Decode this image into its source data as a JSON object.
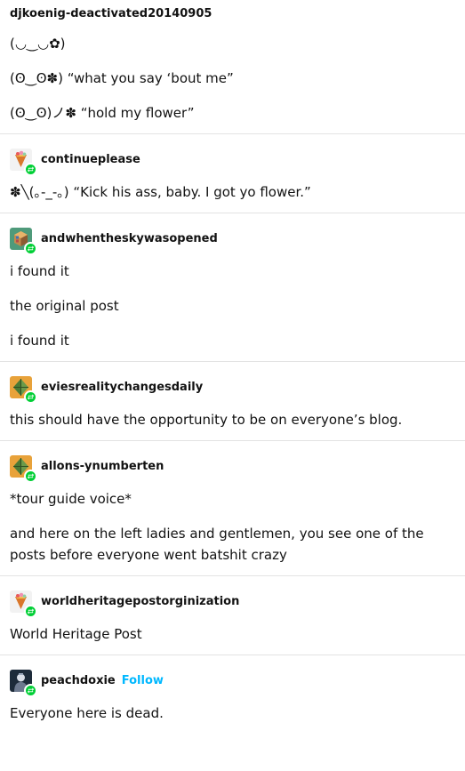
{
  "original": {
    "blog": "djkoenig-deactivated20140905",
    "paragraphs": [
      "(◡‿◡✿)",
      "(ʘ‿ʘ✽) “what you say ‘bout me”",
      "(ʘ‿ʘ)ノ✽ “hold my flower”"
    ]
  },
  "reblogs": [
    {
      "blog": "continueplease",
      "avatar": "ice-cream-cone-avatar",
      "paragraphs": [
        "✽╲(｡-_-｡) “Kick his ass, baby.  I got yo flower.”"
      ]
    },
    {
      "blog": "andwhentheskywasopened",
      "avatar": "cube-avatar",
      "paragraphs": [
        "i found it",
        "the original post",
        "i found it"
      ]
    },
    {
      "blog": "eviesrealitychangesdaily",
      "avatar": "polyhedron-avatar",
      "paragraphs": [
        "this should have the opportunity to be on everyone’s blog."
      ]
    },
    {
      "blog": "allons-ynumberten",
      "avatar": "polyhedron-avatar",
      "paragraphs": [
        "*tour guide voice*",
        "and here on the left ladies and gentlemen, you see one of the posts before everyone went batshit crazy"
      ]
    },
    {
      "blog": "worldheritagepostorginization",
      "avatar": "ice-cream-cone-avatar",
      "paragraphs": [
        "World Heritage Post"
      ]
    },
    {
      "blog": "peachdoxie",
      "avatar": "portrait-avatar",
      "follow_label": "Follow",
      "paragraphs": [
        "Everyone here is dead."
      ]
    }
  ],
  "colors": {
    "reblog_badge": "#00cf35",
    "follow_link": "#00b8ff",
    "divider": "#e3e3e3"
  }
}
